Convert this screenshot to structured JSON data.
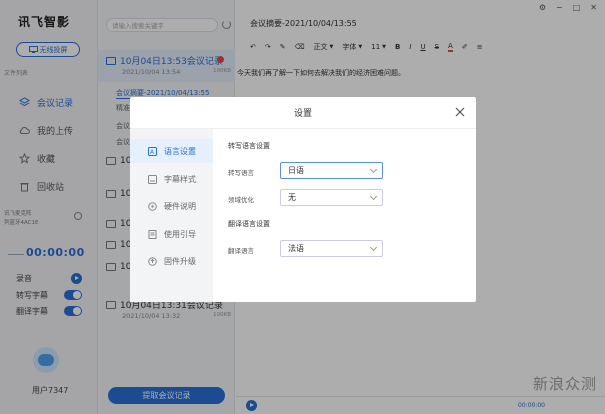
{
  "sidebar": {
    "logo": "讯飞智影",
    "wireless_button": "无线投屏",
    "file_list_label": "文件列表",
    "nav": [
      {
        "label": "会议记录",
        "icon": "layers-icon",
        "active": true
      },
      {
        "label": "我的上传",
        "icon": "cloud-upload-icon",
        "active": false
      },
      {
        "label": "收藏",
        "icon": "star-icon",
        "active": false
      },
      {
        "label": "回收站",
        "icon": "trash-icon",
        "active": false
      }
    ],
    "device_line1": "讯飞麦克阵",
    "device_line2": "列蓝牙4AC1E",
    "timer": "00:00:00",
    "toggles": [
      {
        "label": "录音",
        "type": "play"
      },
      {
        "label": "转写字幕",
        "type": "switch"
      },
      {
        "label": "翻译字幕",
        "type": "switch"
      }
    ],
    "user": "用户7347"
  },
  "list": {
    "search_placeholder": "请输入搜索关键字",
    "selected_item": {
      "title": "10月04日13:53会议记录",
      "date": "2021/10/04 13:54",
      "size": "100KB"
    },
    "sub_items": [
      "会议摘要-2021/10/04/13:55",
      "精准转写",
      "会议",
      "会议"
    ],
    "items": [
      {
        "title": "10",
        "date": "",
        "size": ""
      },
      {
        "title": "10",
        "date": "",
        "size": ""
      },
      {
        "title": "10",
        "date": "",
        "size": ""
      },
      {
        "title": "10",
        "date": "",
        "size": ""
      },
      {
        "title": "10",
        "date": "",
        "size": ""
      },
      {
        "title": "10月04日13:31会议记录",
        "date": "2021/10/04 13:32",
        "size": "100KB"
      }
    ],
    "extract_button": "提取会议记录"
  },
  "editor": {
    "title": "会议摘要-2021/10/04/13:55",
    "toolbar": {
      "style_label": "正文",
      "font_label": "字体",
      "size_label": "11"
    },
    "content": "今天我们再了解一下如何去解决我们的经济困难问题。",
    "time_readout": "00:00:00"
  },
  "watermark": "新浪众测",
  "dialog": {
    "title": "设置",
    "tabs": [
      {
        "label": "语言设置",
        "icon": "language-icon",
        "active": true
      },
      {
        "label": "字幕样式",
        "icon": "subtitle-icon",
        "active": false
      },
      {
        "label": "硬件说明",
        "icon": "hardware-icon",
        "active": false
      },
      {
        "label": "使用引导",
        "icon": "guide-icon",
        "active": false
      },
      {
        "label": "固件升级",
        "icon": "firmware-icon",
        "active": false
      }
    ],
    "transcription_section": "转写语言设置",
    "transcription_lang_label": "转写语言",
    "transcription_lang_value": "日语",
    "domain_opt_label": "领域优化",
    "domain_opt_value": "无",
    "translation_section": "翻译语言设置",
    "translation_lang_label": "翻译语言",
    "translation_lang_value": "法语"
  },
  "colors": {
    "accent": "#2a6fd6",
    "record_red": "#e34b4b"
  }
}
